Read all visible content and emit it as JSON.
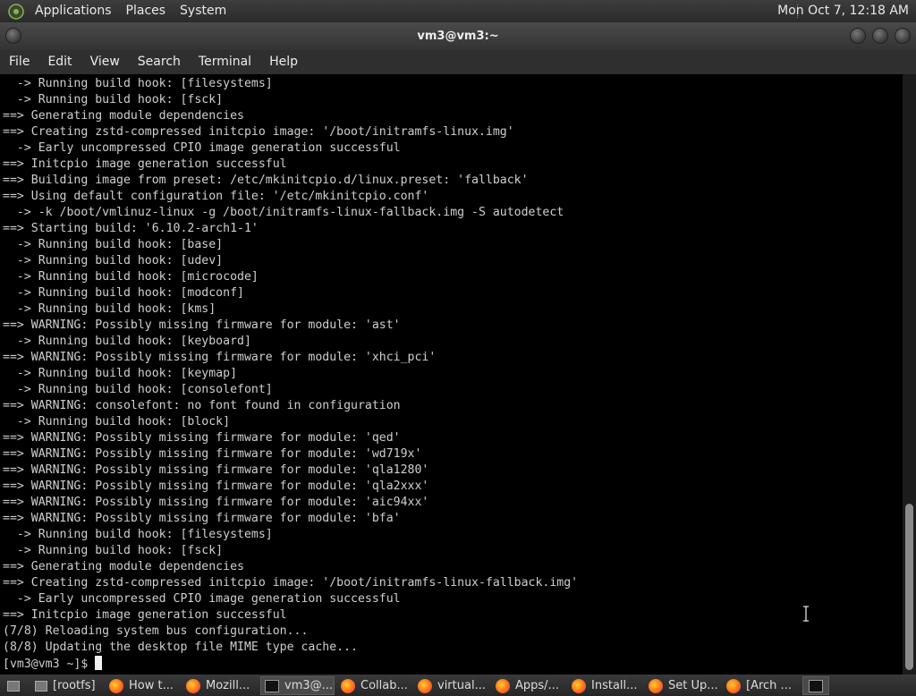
{
  "top_panel": {
    "menus": [
      "Applications",
      "Places",
      "System"
    ],
    "clock": "Mon Oct  7, 12:18 AM"
  },
  "window": {
    "title": "vm3@vm3:~"
  },
  "menubar": [
    "File",
    "Edit",
    "View",
    "Search",
    "Terminal",
    "Help"
  ],
  "terminal": {
    "lines": [
      "  -> Running build hook: [filesystems]",
      "  -> Running build hook: [fsck]",
      "==> Generating module dependencies",
      "==> Creating zstd-compressed initcpio image: '/boot/initramfs-linux.img'",
      "  -> Early uncompressed CPIO image generation successful",
      "==> Initcpio image generation successful",
      "==> Building image from preset: /etc/mkinitcpio.d/linux.preset: 'fallback'",
      "==> Using default configuration file: '/etc/mkinitcpio.conf'",
      "  -> -k /boot/vmlinuz-linux -g /boot/initramfs-linux-fallback.img -S autodetect",
      "==> Starting build: '6.10.2-arch1-1'",
      "  -> Running build hook: [base]",
      "  -> Running build hook: [udev]",
      "  -> Running build hook: [microcode]",
      "  -> Running build hook: [modconf]",
      "  -> Running build hook: [kms]",
      "==> WARNING: Possibly missing firmware for module: 'ast'",
      "  -> Running build hook: [keyboard]",
      "==> WARNING: Possibly missing firmware for module: 'xhci_pci'",
      "  -> Running build hook: [keymap]",
      "  -> Running build hook: [consolefont]",
      "==> WARNING: consolefont: no font found in configuration",
      "  -> Running build hook: [block]",
      "==> WARNING: Possibly missing firmware for module: 'qed'",
      "==> WARNING: Possibly missing firmware for module: 'wd719x'",
      "==> WARNING: Possibly missing firmware for module: 'qla1280'",
      "==> WARNING: Possibly missing firmware for module: 'qla2xxx'",
      "==> WARNING: Possibly missing firmware for module: 'aic94xx'",
      "==> WARNING: Possibly missing firmware for module: 'bfa'",
      "  -> Running build hook: [filesystems]",
      "  -> Running build hook: [fsck]",
      "==> Generating module dependencies",
      "==> Creating zstd-compressed initcpio image: '/boot/initramfs-linux-fallback.img'",
      "  -> Early uncompressed CPIO image generation successful",
      "==> Initcpio image generation successful",
      "(7/8) Reloading system bus configuration...",
      "(8/8) Updating the desktop file MIME type cache..."
    ],
    "prompt": "[vm3@vm3 ~]$"
  },
  "taskbar": {
    "items": [
      {
        "label": "[rootfs]",
        "icon": "folder-icon"
      },
      {
        "label": "How t...",
        "icon": "firefox-icon"
      },
      {
        "label": "Mozill...",
        "icon": "firefox-icon"
      },
      {
        "label": "vm3@...",
        "icon": "terminal-icon"
      },
      {
        "label": "Collab...",
        "icon": "firefox-icon"
      },
      {
        "label": "virtual...",
        "icon": "firefox-icon"
      },
      {
        "label": "Apps/...",
        "icon": "firefox-icon"
      },
      {
        "label": "Install...",
        "icon": "firefox-icon"
      },
      {
        "label": "Set Up...",
        "icon": "firefox-icon"
      },
      {
        "label": "[Arch ...",
        "icon": "firefox-icon"
      }
    ]
  }
}
